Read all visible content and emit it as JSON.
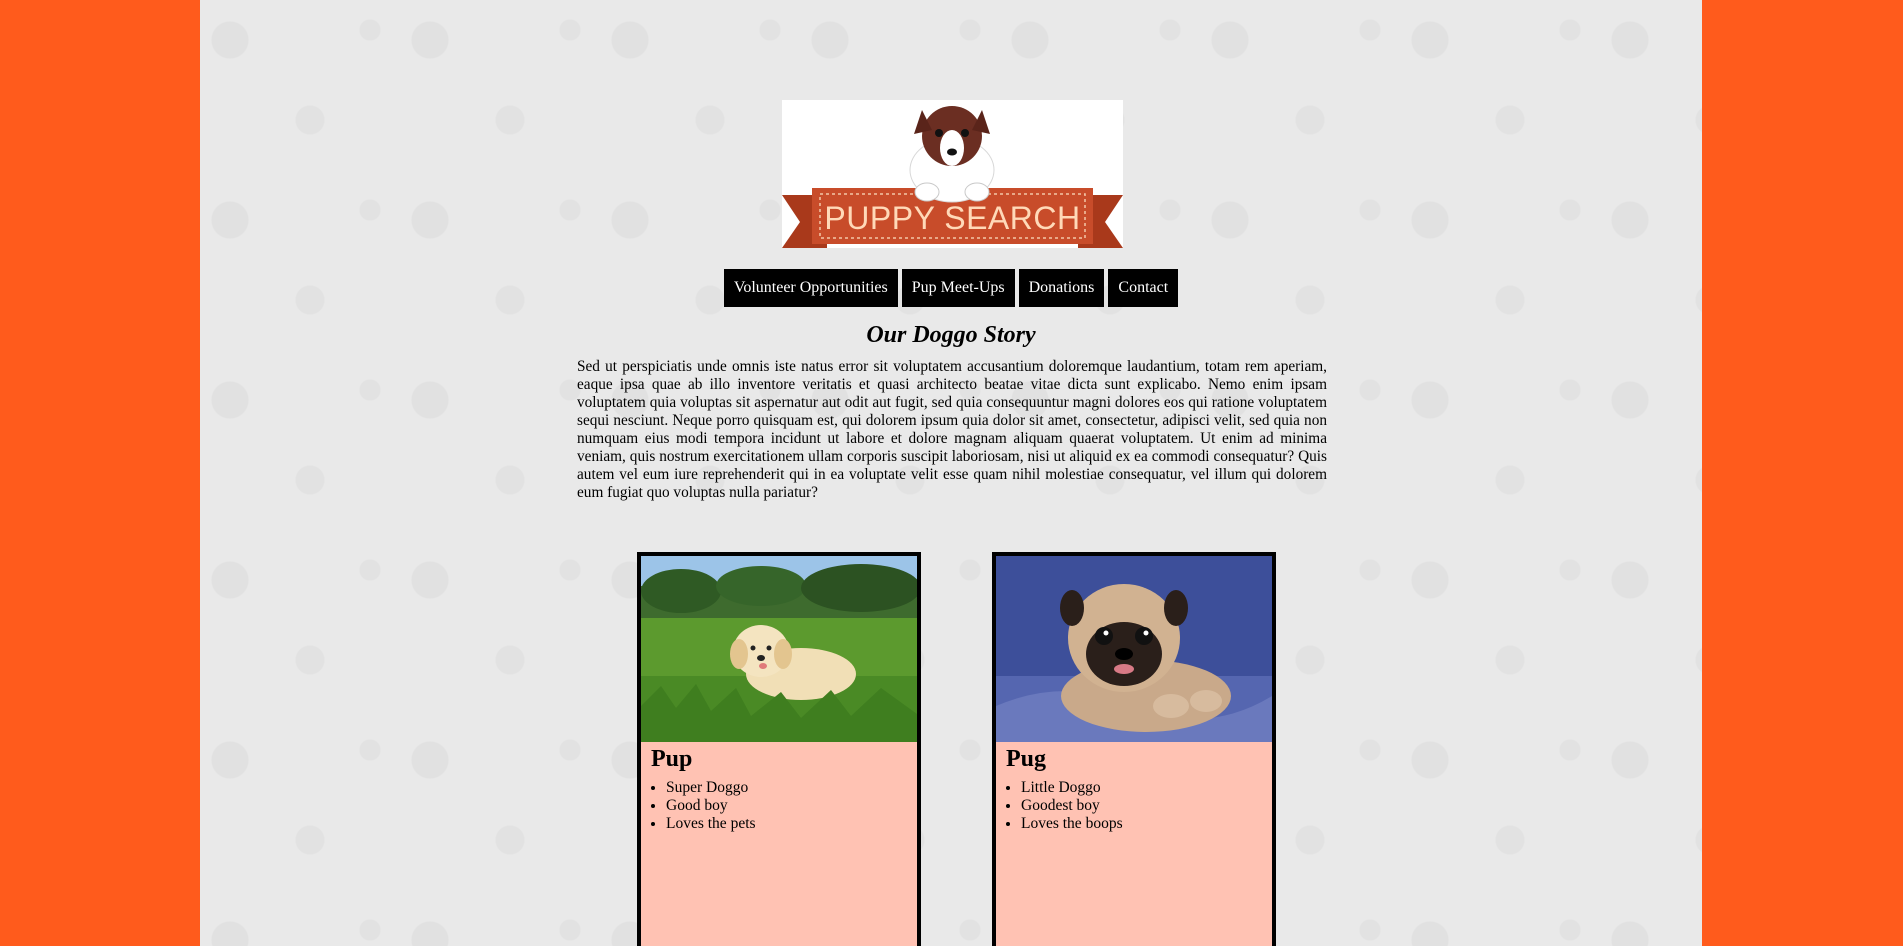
{
  "logo": {
    "text": "PUPPY SEARCH",
    "ribbon_color": "#c84c2a",
    "icon": "puppy-logo"
  },
  "nav": {
    "items": [
      {
        "label": "Volunteer Opportunities"
      },
      {
        "label": "Pup Meet-Ups"
      },
      {
        "label": "Donations"
      },
      {
        "label": "Contact"
      }
    ]
  },
  "story": {
    "title": "Our Doggo Story",
    "text": "Sed ut perspiciatis unde omnis iste natus error sit voluptatem accusantium doloremque laudantium, totam rem aperiam, eaque ipsa quae ab illo inventore veritatis et quasi architecto beatae vitae dicta sunt explicabo. Nemo enim ipsam voluptatem quia voluptas sit aspernatur aut odit aut fugit, sed quia consequuntur magni dolores eos qui ratione voluptatem sequi nesciunt. Neque porro quisquam est, qui dolorem ipsum quia dolor sit amet, consectetur, adipisci velit, sed quia non numquam eius modi tempora incidunt ut labore et dolore magnam aliquam quaerat voluptatem. Ut enim ad minima veniam, quis nostrum exercitationem ullam corporis suscipit laboriosam, nisi ut aliquid ex ea commodi consequatur? Quis autem vel eum iure reprehenderit qui in ea voluptate velit esse quam nihil molestiae consequatur, vel illum qui dolorem eum fugiat quo voluptas nulla pariatur?"
  },
  "cards": [
    {
      "title": "Pup",
      "photo": "golden-retriever-puppy-photo",
      "items": [
        "Super Doggo",
        "Good boy",
        "Loves the pets"
      ]
    },
    {
      "title": "Pug",
      "photo": "pug-puppy-photo",
      "items": [
        "Little Doggo",
        "Goodest boy",
        "Loves the boops"
      ]
    }
  ],
  "colors": {
    "page_side": "#ff5b1c",
    "content_bg": "#e9e9e9",
    "nav_bg": "#000000",
    "card_bg": "#ffc2b3"
  }
}
